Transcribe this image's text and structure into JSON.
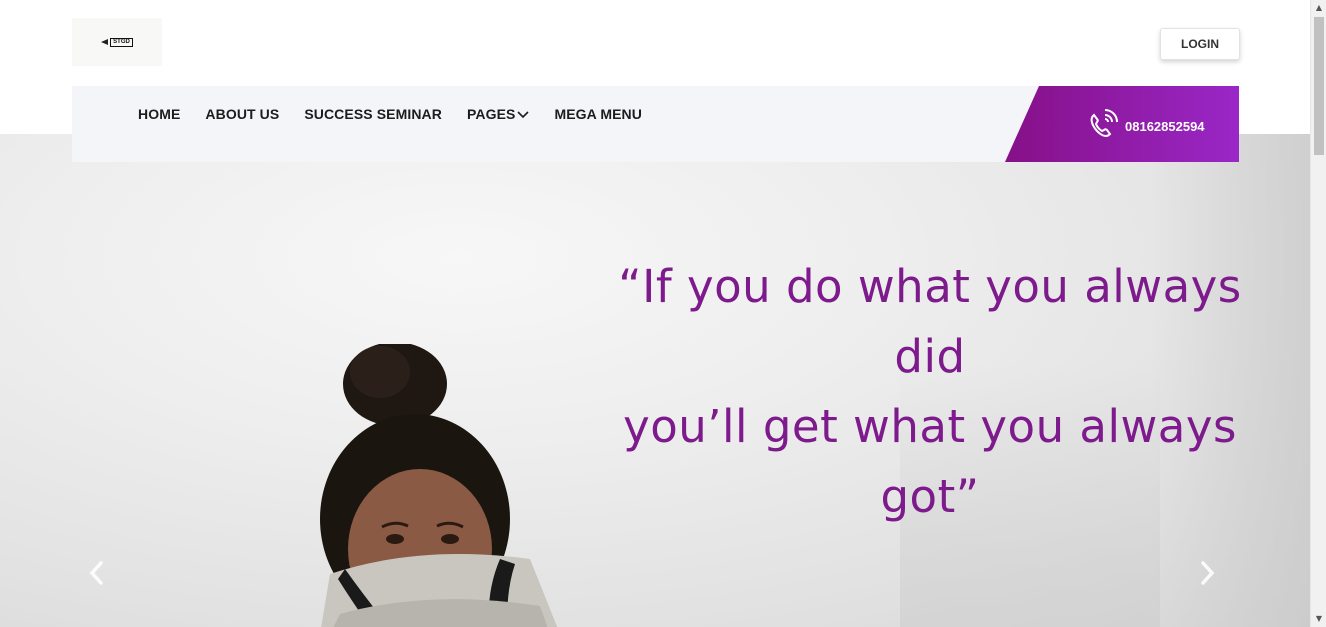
{
  "header": {
    "logo_text": "STGD",
    "login_label": "LOGIN"
  },
  "nav": {
    "items": [
      {
        "label": "HOME"
      },
      {
        "label": "ABOUT US"
      },
      {
        "label": "SUCCESS SEMINAR"
      },
      {
        "label": "PAGES",
        "has_dropdown": true
      },
      {
        "label": "MEGA MENU"
      }
    ],
    "phone_number": "08162852594",
    "phone_icon": "phone-ringing-icon"
  },
  "hero": {
    "quote_line1": "“If you do what you always did",
    "quote_line2": "you’ll get what you always got”",
    "prev_icon": "chevron-left-icon",
    "next_icon": "chevron-right-icon"
  },
  "colors": {
    "accent": "#861087",
    "accent_end": "#9a27c7",
    "quote": "#7d1a8c",
    "nav_bg": "#f4f5f9"
  }
}
